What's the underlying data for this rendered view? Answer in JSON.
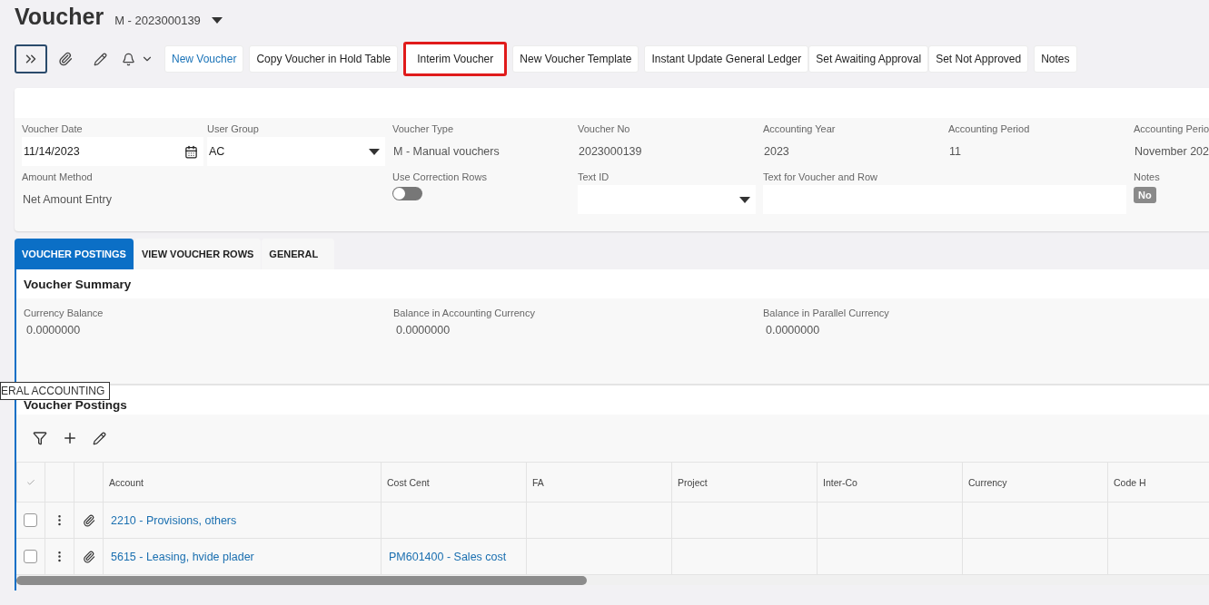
{
  "page": {
    "title": "Voucher",
    "record": "M - 2023000139"
  },
  "toolbar": {
    "buttons": [
      {
        "label": "New Voucher",
        "kind": "link",
        "highlighted": false
      },
      {
        "label": "Copy Voucher in Hold Table",
        "kind": "plain",
        "highlighted": false
      },
      {
        "label": "Interim Voucher",
        "kind": "plain",
        "highlighted": true
      },
      {
        "label": "New Voucher Template",
        "kind": "plain",
        "highlighted": false
      },
      {
        "label": "Instant Update General Ledger",
        "kind": "plain",
        "highlighted": false
      },
      {
        "label": "Set Awaiting Approval",
        "kind": "joined",
        "highlighted": false
      },
      {
        "label": "Set Not Approved",
        "kind": "joined",
        "highlighted": false
      },
      {
        "label": "Notes",
        "kind": "plain",
        "highlighted": false
      }
    ]
  },
  "header_fields": [
    {
      "label": "Voucher Date",
      "kind": "date",
      "value": "11/14/2023"
    },
    {
      "label": "User Group",
      "kind": "select",
      "value": "AC"
    },
    {
      "label": "Voucher Type",
      "kind": "readonly",
      "value": "M - Manual vouchers"
    },
    {
      "label": "Voucher No",
      "kind": "readonly",
      "value": "2023000139"
    },
    {
      "label": "Accounting Year",
      "kind": "readonly",
      "value": "2023"
    },
    {
      "label": "Accounting Period",
      "kind": "readonly",
      "value": "11"
    },
    {
      "label": "Accounting Perio",
      "kind": "readonly",
      "value": "November 202"
    },
    {
      "label": "Amount Method",
      "kind": "readonly",
      "value": "Net Amount Entry"
    },
    {
      "label": "Use Correction Rows",
      "kind": "toggle",
      "on": false
    },
    {
      "label": "Text ID",
      "kind": "select"
    },
    {
      "label": "Text for Voucher and Row",
      "kind": "wide_text"
    },
    {
      "label": "Notes",
      "kind": "badge",
      "value": "No"
    }
  ],
  "tabs": [
    {
      "label": "VOUCHER POSTINGS",
      "selected": true
    },
    {
      "label": "VIEW VOUCHER ROWS",
      "selected": false
    },
    {
      "label": "GENERAL",
      "selected": false
    }
  ],
  "summary": {
    "title": "Voucher Summary",
    "fields": [
      {
        "label": "Currency Balance",
        "value": "0.0000000"
      },
      {
        "label": "Balance in Accounting Currency",
        "value": "0.0000000"
      },
      {
        "label": "Balance in Parallel Currency",
        "value": "0.0000000"
      }
    ]
  },
  "tooltip": "ERAL ACCOUNTING",
  "postings": {
    "title": "Voucher Postings",
    "columns": [
      "Account",
      "Cost Cent",
      "FA",
      "Project",
      "Inter-Co",
      "Currency",
      "Code H"
    ],
    "rows": [
      {
        "checked": false,
        "cells": [
          "2210 - Provisions, others",
          "",
          "",
          "",
          "",
          "",
          ""
        ]
      },
      {
        "checked": false,
        "cells": [
          "5615 - Leasing, hvide plader",
          "PM601400 - Sales cost",
          "",
          "",
          "",
          "",
          ""
        ]
      }
    ]
  }
}
